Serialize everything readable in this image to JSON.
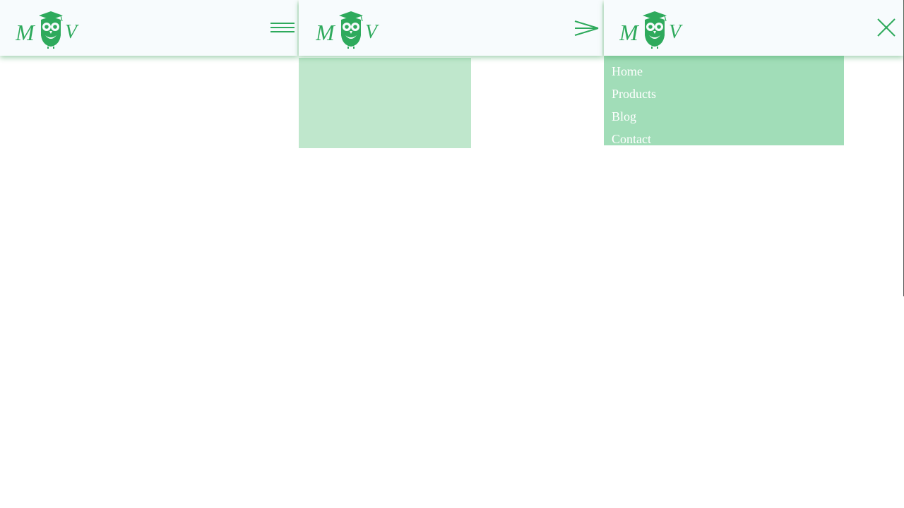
{
  "brand": {
    "logo_letters": "MOV",
    "accent_color": "#2eaa5c"
  },
  "states": [
    {
      "id": "closed",
      "toggle_icon": "hamburger-icon"
    },
    {
      "id": "opening",
      "toggle_icon": "arrow-right-icon"
    },
    {
      "id": "open",
      "toggle_icon": "close-icon",
      "nav": [
        {
          "label": "Home"
        },
        {
          "label": "Products"
        },
        {
          "label": "Blog"
        },
        {
          "label": "Contact"
        }
      ]
    }
  ],
  "colors": {
    "header_bg": "#f7fbfd",
    "drawer_partial_bg": "#bfe7cc",
    "drawer_open_bg": "#a1ddb8",
    "nav_text": "#ffffff"
  }
}
